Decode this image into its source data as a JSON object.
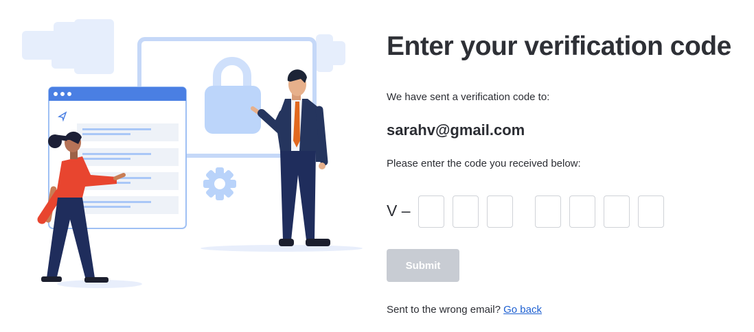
{
  "heading": "Enter your verification code",
  "sent_message": "We have sent a verification code to:",
  "email": "sarahv@gmail.com",
  "instruction": "Please enter the code you received below:",
  "code_prefix": "V –",
  "code_boxes_first_group": 3,
  "code_boxes_second_group": 4,
  "submit_label": "Submit",
  "footer": {
    "question": "Sent to the wrong email?",
    "link_label": "Go back"
  },
  "colors": {
    "heading": "#2e3036",
    "submit_disabled": "#c8ccd3",
    "link": "#1c5fd1",
    "illustration_light_blue": "#cfe0fb",
    "illustration_blue": "#5b8de8"
  },
  "illustration": {
    "icons": [
      "lock-icon",
      "gear-icon",
      "send-icon"
    ]
  }
}
